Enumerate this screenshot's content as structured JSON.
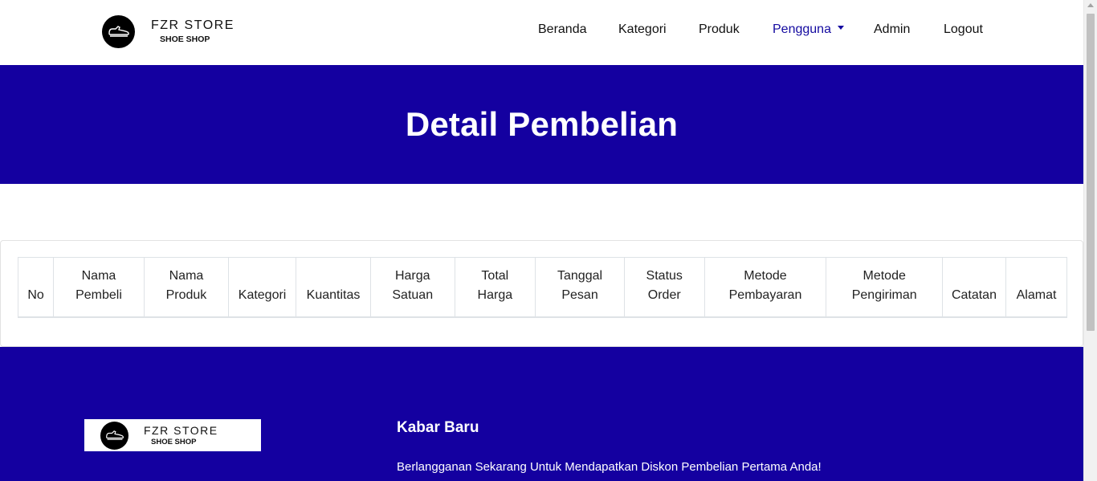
{
  "brand": {
    "name": "FZR STORE",
    "subtitle": "SHOE SHOP",
    "logo_icon": "shoe-icon"
  },
  "nav": {
    "items": [
      {
        "label": "Beranda"
      },
      {
        "label": "Kategori"
      },
      {
        "label": "Produk"
      },
      {
        "label": "Pengguna",
        "active": true,
        "dropdown": true
      },
      {
        "label": "Admin"
      },
      {
        "label": "Logout"
      }
    ]
  },
  "hero": {
    "title": "Detail Pembelian"
  },
  "table": {
    "columns": [
      "No",
      "Nama Pembeli",
      "Nama Produk",
      "Kategori",
      "Kuantitas",
      "Harga Satuan",
      "Total Harga",
      "Tanggal Pesan",
      "Status Order",
      "Metode Pembayaran",
      "Metode Pengiriman",
      "Catatan",
      "Alamat"
    ],
    "rows": []
  },
  "footer": {
    "heading": "Kabar Baru",
    "text": "Berlangganan Sekarang Untuk Mendapatkan Diskon Pembelian Pertama Anda!"
  },
  "colors": {
    "primary": "#1400a0",
    "active_nav": "#140aa0"
  }
}
